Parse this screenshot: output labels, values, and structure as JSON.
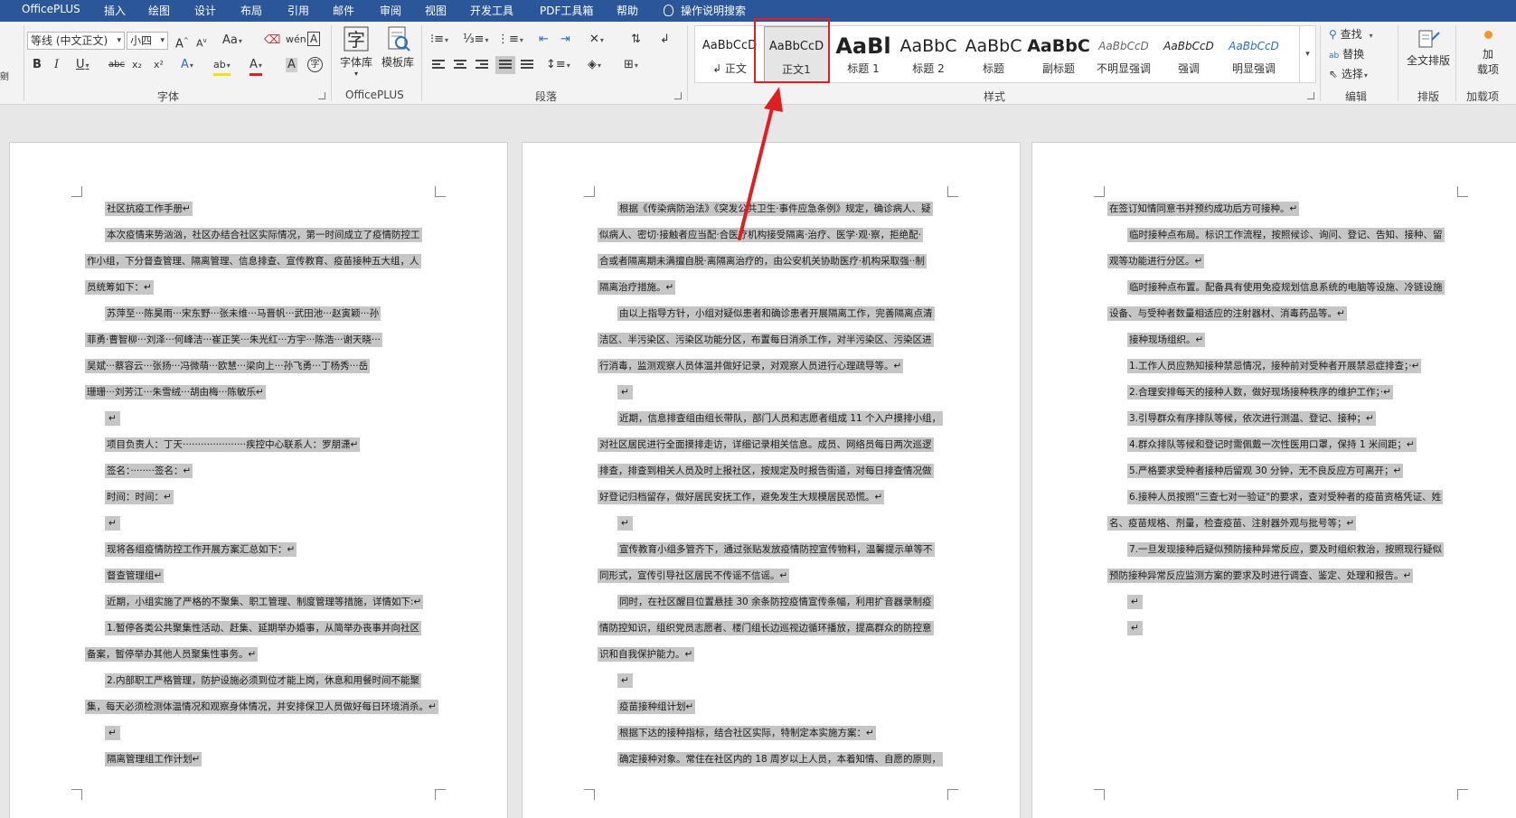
{
  "menubar": {
    "items": [
      "OfficePLUS",
      "插入",
      "绘图",
      "设计",
      "布局",
      "引用",
      "邮件",
      "审阅",
      "视图",
      "开发工具",
      "PDF工具箱",
      "帮助"
    ],
    "tell_me": "操作说明搜索"
  },
  "ribbon": {
    "font": {
      "font_name": "等线 (中文正文)",
      "font_size": "小四",
      "group_label": "字体",
      "aa_label": "Aa",
      "clear_label": "A",
      "border_char_label": "A",
      "bold": "B",
      "italic": "I",
      "underline": "U",
      "strike": "abc",
      "subscript": "x₂",
      "superscript": "x²",
      "text_effects": "A",
      "highlight": "ab",
      "font_color": "A",
      "char_shading": "A",
      "enclose": "字"
    },
    "officeplus": {
      "font_lib": "字体库",
      "template_lib": "模板库",
      "group_label": "OfficePLUS"
    },
    "paragraph": {
      "group_label": "段落"
    },
    "styles": {
      "group_label": "样式",
      "items": [
        {
          "preview": "AaBbCcD",
          "name": "↲ 正文"
        },
        {
          "preview": "AaBbCcD",
          "name": "正文1"
        },
        {
          "preview": "AaBl",
          "name": "标题 1"
        },
        {
          "preview": "AaBbC",
          "name": "标题 2"
        },
        {
          "preview": "AaBbC",
          "name": "标题"
        },
        {
          "preview": "AaBbC",
          "name": "副标题"
        },
        {
          "preview": "AaBbCcD",
          "name": "不明显强调"
        },
        {
          "preview": "AaBbCcD",
          "name": "强调"
        },
        {
          "preview": "AaBbCcD",
          "name": "明显强调"
        }
      ]
    },
    "editing": {
      "find": "查找",
      "replace": "替换",
      "select": "选择",
      "group_label": "编辑"
    },
    "layout": {
      "button": "全文排版",
      "group_label": "排版"
    },
    "addins": {
      "button_line1": "加",
      "button_line2": "载项",
      "group_label": "加载项"
    }
  },
  "pages": [
    {
      "lines": [
        {
          "t": "社区抗疫工作手册↵",
          "ind": true
        },
        {
          "t": "本次疫情来势汹汹，社区办结合社区实际情况，第一时间成立了疫情防控工",
          "ind": true
        },
        {
          "t": "作小组，下分督查管理、隔离管理、信息排查、宣传教育、疫苗接种五大组，人",
          "ind": false
        },
        {
          "t": "员统筹如下：↵",
          "ind": false
        },
        {
          "t": "苏萍至···陈昊雨···宋东野···张未维···马晋帆···武田池···赵寅颖···孙",
          "ind": true
        },
        {
          "t": "菲勇·曹智柳···刘泽···何峰洁···崔正笑···朱光红···方宇···陈浩···谢天晓···",
          "ind": false
        },
        {
          "t": "吴斌···蔡容云···张扬···冯微萌···欧慧···梁向上···孙飞勇···丁杨秀···岳",
          "ind": false
        },
        {
          "t": "珊珊···刘芳江···朱雪绒···胡由梅···陈敏乐↵",
          "ind": false
        },
        {
          "t": "↵",
          "ind": true,
          "empty": true
        },
        {
          "t": "项目负责人：丁天·····················疾控中心联系人：罗朋潇↵",
          "ind": true
        },
        {
          "t": "签名：········签名：↵",
          "ind": true
        },
        {
          "t": "时间：时间：↵",
          "ind": true
        },
        {
          "t": "↵",
          "ind": true,
          "empty": true
        },
        {
          "t": "现将各组疫情防控工作开展方案汇总如下：↵",
          "ind": true
        },
        {
          "t": "督查管理组↵",
          "ind": true
        },
        {
          "t": "近期，小组实施了严格的不聚集、职工管理、制度管理等措施，详情如下:↵",
          "ind": true
        },
        {
          "t": "1.暂停各类公共聚集性活动、赶集、延期举办婚事，从简举办丧事并向社区",
          "ind": true
        },
        {
          "t": "备案，暂停举办其他人员聚集性事务。↵",
          "ind": false
        },
        {
          "t": "2.内部职工严格管理，防护设施必须到位才能上岗，休息和用餐时间不能聚",
          "ind": true
        },
        {
          "t": "集，每天必须检测体温情况和观察身体情况，并安排保卫人员做好每日环境消杀。↵",
          "ind": false
        },
        {
          "t": "↵",
          "ind": true,
          "empty": true
        },
        {
          "t": "隔离管理组工作计划↵",
          "ind": true
        }
      ]
    },
    {
      "lines": [
        {
          "t": "根据《传染病防治法》《突发公共卫生·事件应急条例》规定，确诊病人、疑",
          "ind": true
        },
        {
          "t": "似病人、密切·接触者应当配·合医疗机构接受隔离·治疗、医学·观·察，拒绝配·",
          "ind": false
        },
        {
          "t": "合或者隔离期未满擅自脱·离隔离治疗的，由公安机关协助医疗·机构采取强··制",
          "ind": false
        },
        {
          "t": "隔离治疗措施。↵",
          "ind": false
        },
        {
          "t": "由以上指导方针，小组对疑似患者和确诊患者开展隔离工作，完善隔离点清",
          "ind": true
        },
        {
          "t": "洁区、半污染区、污染区功能分区，布置每日消杀工作，对半污染区、污染区进",
          "ind": false
        },
        {
          "t": "行消毒，监测观察人员体温并做好记录，对观察人员进行心理疏导等。↵",
          "ind": false
        },
        {
          "t": "↵",
          "ind": true,
          "empty": true
        },
        {
          "t": "近期，信息排查组由组长带队，部门人员和志愿者组成 11 个入户摸排小组，",
          "ind": true
        },
        {
          "t": "对社区居民进行全面摸排走访，详细记录相关信息。成员、网络员每日两次巡逻",
          "ind": false
        },
        {
          "t": "排查，排查到相关人员及时上报社区，按规定及时报告街道，对每日排查情况做",
          "ind": false
        },
        {
          "t": "好登记归档留存，做好居民安抚工作，避免发生大规模居民恐慌。↵",
          "ind": false
        },
        {
          "t": "↵",
          "ind": true,
          "empty": true
        },
        {
          "t": "宣传教育小组多管齐下，通过张贴发放疫情防控宣传物料，温馨提示单等不",
          "ind": true
        },
        {
          "t": "同形式，宣传引导社区居民不传谣不信谣。↵",
          "ind": false
        },
        {
          "t": "同时，在社区醒目位置悬挂 30 余条防控疫情宣传条幅，利用扩音器录制疫",
          "ind": true
        },
        {
          "t": "情防控知识，组织党员志愿者、楼门组长边巡视边循环播放，提高群众的防控意",
          "ind": false
        },
        {
          "t": "识和自我保护能力。↵",
          "ind": false
        },
        {
          "t": "↵",
          "ind": true,
          "empty": true
        },
        {
          "t": "疫苗接种组计划↵",
          "ind": true
        },
        {
          "t": "根据下达的接种指标，结合社区实际，特制定本实施方案：↵",
          "ind": true
        },
        {
          "t": "确定接种对象。常住在社区内的 18 周岁以上人员，本着知情、自愿的原则，",
          "ind": true
        }
      ]
    },
    {
      "lines": [
        {
          "t": "在签订知情同意书并预约成功后方可接种。↵",
          "ind": false
        },
        {
          "t": "临时接种点布局。标识工作流程，按照候诊、询问、登记、告知、接种、留",
          "ind": true
        },
        {
          "t": "观等功能进行分区。↵",
          "ind": false
        },
        {
          "t": "临时接种点布置。配备具有使用免疫规划信息系统的电脑等设施、冷链设施",
          "ind": true
        },
        {
          "t": "设备、与受种者数量相适应的注射器材、消毒药品等。↵",
          "ind": false
        },
        {
          "t": "接种现场组织。↵",
          "ind": true
        },
        {
          "t": "1.工作人员应熟知接种禁忌情况，接种前对受种者开展禁忌症排查；·↵",
          "ind": true
        },
        {
          "t": "2.合理安排每天的接种人数，做好现场接种秩序的维护工作；·↵",
          "ind": true
        },
        {
          "t": "3.引导群众有序排队等候，依次进行测温、登记、接种；↵",
          "ind": true
        },
        {
          "t": "4.群众排队等候和登记时需佩戴一次性医用口罩，保持 1 米间距；↵",
          "ind": true
        },
        {
          "t": "5.严格要求受种者接种后留观 30 分钟，无不良反应方可离开；↵",
          "ind": true
        },
        {
          "t": "6.接种人员按照\"三查七对一验证\"的要求，查对受种者的疫苗资格凭证、姓",
          "ind": true
        },
        {
          "t": "名、疫苗规格、剂量，检查疫苗、注射器外观与批号等；↵",
          "ind": false
        },
        {
          "t": "7.一旦发现接种后疑似预防接种异常反应，要及时组织救治，按照现行疑似",
          "ind": true
        },
        {
          "t": "预防接种异常反应监测方案的要求及时进行调查、鉴定、处理和报告。↵",
          "ind": false
        },
        {
          "t": "↵",
          "ind": true,
          "empty": true
        },
        {
          "t": "↵",
          "ind": true,
          "empty": true
        }
      ]
    }
  ],
  "colors": {
    "menubar": "#2b579a",
    "annotation": "#e02020",
    "selection": "#c6c6c6"
  }
}
